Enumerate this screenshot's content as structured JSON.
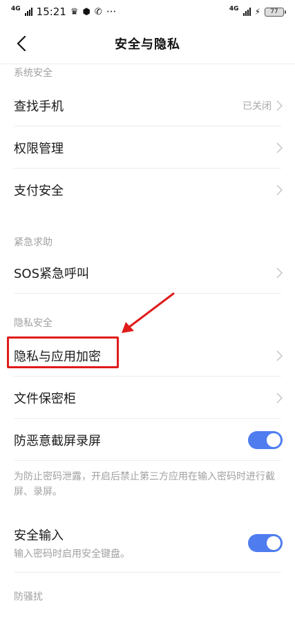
{
  "status_bar": {
    "network_left": "4G",
    "time": "15:21",
    "more": "···",
    "network_right": "4G",
    "battery": "77",
    "icons": [
      "signal-icon",
      "crown-icon",
      "shield-icon",
      "phone-missed-icon",
      "charging-icon"
    ]
  },
  "nav": {
    "title": "安全与隐私"
  },
  "sections": {
    "system": {
      "header": "系统安全",
      "items": [
        {
          "label": "查找手机",
          "value": "已关闭"
        },
        {
          "label": "权限管理"
        },
        {
          "label": "支付安全"
        }
      ]
    },
    "emergency": {
      "header": "紧急求助",
      "items": [
        {
          "label": "SOS紧急呼叫"
        }
      ]
    },
    "privacy": {
      "header": "隐私安全",
      "items": [
        {
          "label": "隐私与应用加密"
        },
        {
          "label": "文件保密柜"
        },
        {
          "label": "防恶意截屏录屏",
          "toggle_on": true
        }
      ],
      "screenshot_desc": "为防止密码泄露，开启后禁止第三方应用在输入密码时进行截屏、录屏。",
      "secure_input": {
        "label": "安全输入",
        "sub": "输入密码时启用安全键盘。",
        "toggle_on": true
      }
    },
    "anti_harass": {
      "header": "防骚扰"
    }
  },
  "colors": {
    "accent": "#4f7df0",
    "annotation": "#e01b1b",
    "secondary_text": "#a0a0a0"
  }
}
